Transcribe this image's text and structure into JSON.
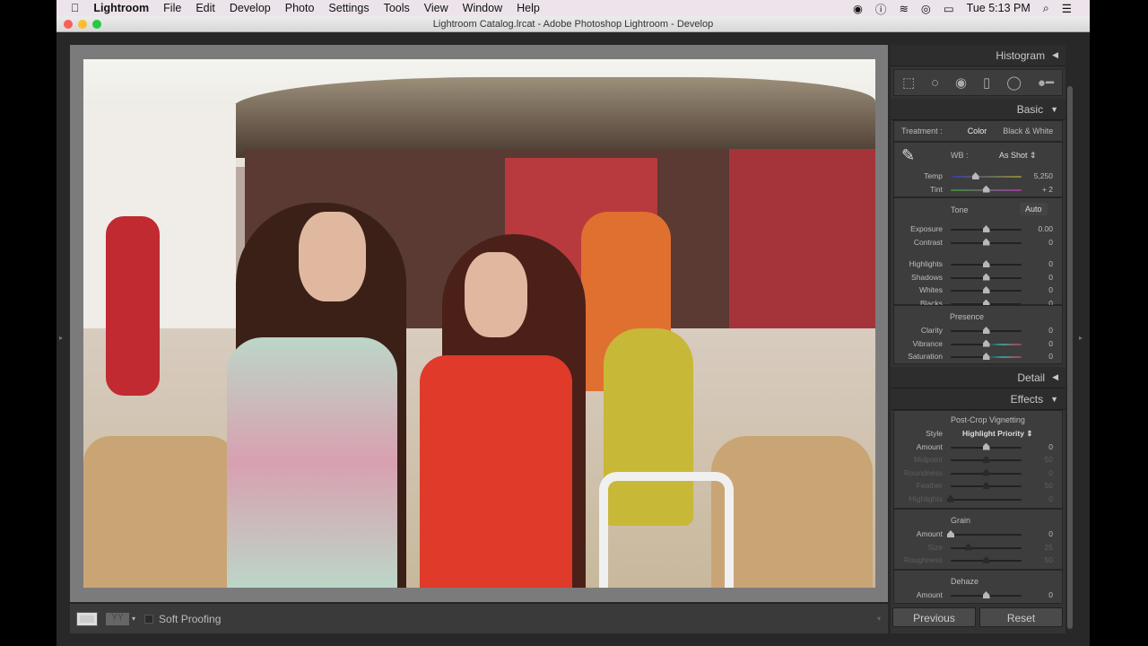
{
  "menubar": {
    "items": [
      "Lightroom",
      "File",
      "Edit",
      "Develop",
      "Photo",
      "Settings",
      "Tools",
      "View",
      "Window",
      "Help"
    ],
    "clock": "Tue 5:13 PM"
  },
  "window": {
    "title": "Lightroom Catalog.lrcat - Adobe Photoshop Lightroom - Develop"
  },
  "toolbar": {
    "soft_proofing": "Soft Proofing"
  },
  "panel": {
    "histogram": "Histogram",
    "basic": "Basic",
    "treatment_label": "Treatment :",
    "treatment_color": "Color",
    "treatment_bw": "Black & White",
    "wb_label": "WB :",
    "wb_value": "As Shot",
    "wb_rows": [
      {
        "label": "Temp",
        "value": "5,250",
        "pos": 0.35,
        "track": "linear-gradient(90deg,#3a3a9a,#8a8a30)"
      },
      {
        "label": "Tint",
        "value": "+ 2",
        "pos": 0.5,
        "track": "linear-gradient(90deg,#3a8a3a,#9a3a9a)"
      }
    ],
    "tone": "Tone",
    "auto": "Auto",
    "tone_rows": [
      {
        "label": "Exposure",
        "value": "0.00",
        "pos": 0.5
      },
      {
        "label": "Contrast",
        "value": "0",
        "pos": 0.5
      }
    ],
    "tone_rows2": [
      {
        "label": "Highlights",
        "value": "0",
        "pos": 0.5
      },
      {
        "label": "Shadows",
        "value": "0",
        "pos": 0.5
      },
      {
        "label": "Whites",
        "value": "0",
        "pos": 0.5
      },
      {
        "label": "Blacks",
        "value": "0",
        "pos": 0.5
      }
    ],
    "presence": "Presence",
    "presence_rows": [
      {
        "label": "Clarity",
        "value": "0",
        "pos": 0.5
      },
      {
        "label": "Vibrance",
        "value": "0",
        "pos": 0.5,
        "track": "linear-gradient(90deg,#222 45%,#3a9a9a,#aa3a5a)"
      },
      {
        "label": "Saturation",
        "value": "0",
        "pos": 0.5,
        "track": "linear-gradient(90deg,#222 45%,#3a9a9a,#aa3a5a)"
      }
    ],
    "detail": "Detail",
    "effects": "Effects",
    "vignette_title": "Post-Crop Vignetting",
    "style_label": "Style",
    "style_value": "Highlight Priority",
    "vignette_rows": [
      {
        "label": "Amount",
        "value": "0",
        "pos": 0.5
      },
      {
        "label": "Midpoint",
        "value": "50",
        "pos": 0.5,
        "dim": true
      },
      {
        "label": "Roundness",
        "value": "0",
        "pos": 0.5,
        "dim": true
      },
      {
        "label": "Feather",
        "value": "50",
        "pos": 0.5,
        "dim": true
      },
      {
        "label": "Highlights",
        "value": "0",
        "pos": 0.0,
        "dim": true
      }
    ],
    "grain_title": "Grain",
    "grain_rows": [
      {
        "label": "Amount",
        "value": "0",
        "pos": 0.0
      },
      {
        "label": "Size",
        "value": "25",
        "pos": 0.25,
        "dim": true
      },
      {
        "label": "Roughness",
        "value": "50",
        "pos": 0.5,
        "dim": true
      }
    ],
    "dehaze_title": "Dehaze",
    "dehaze_rows": [
      {
        "label": "Amount",
        "value": "0",
        "pos": 0.5
      }
    ],
    "previous": "Previous",
    "reset": "Reset"
  }
}
